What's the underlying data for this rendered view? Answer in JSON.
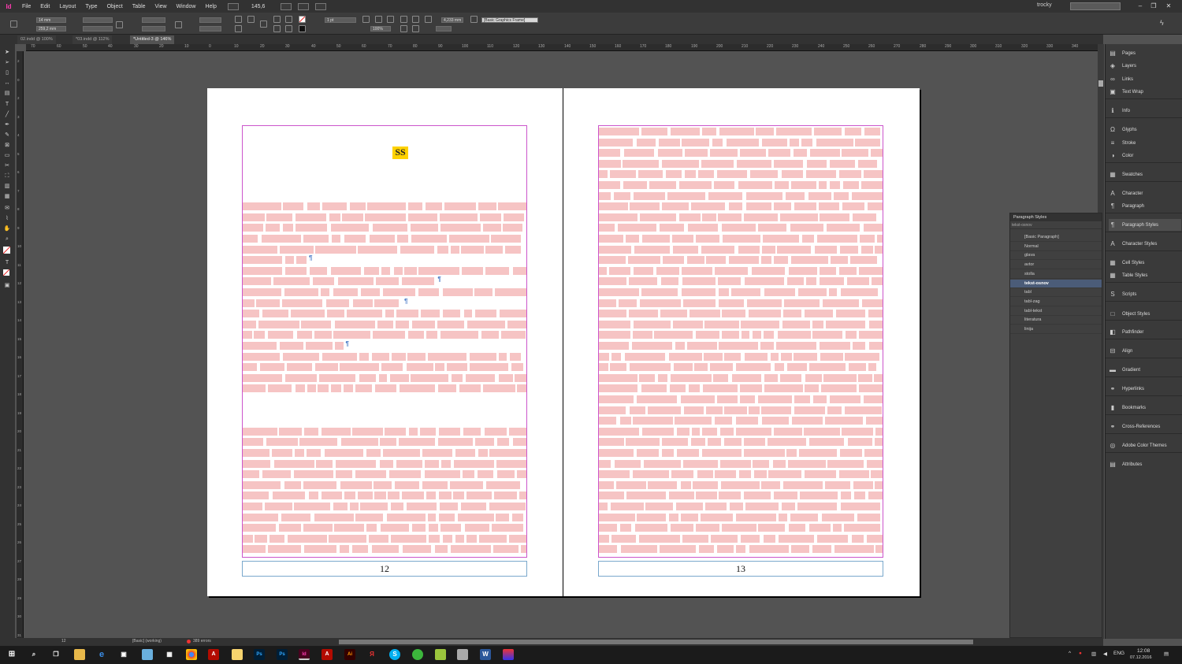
{
  "app": {
    "logo": "Id",
    "menu": [
      "File",
      "Edit",
      "Layout",
      "Type",
      "Object",
      "Table",
      "View",
      "Window",
      "Help"
    ],
    "zoom": "145,6",
    "user": "trocky"
  },
  "control_bar": {
    "x_value": "14 mm",
    "y_value": "259,2 mm",
    "stroke_weight": "1 pt",
    "scale_percent": "100%",
    "measure": "4,233 mm",
    "frame_style": "[Basic Graphics Frame]"
  },
  "tabs": [
    "02.indd @ 100%",
    "*03.indd @ 112%",
    "*Untitled-3 @ 146%"
  ],
  "ruler_top": [
    "70",
    "60",
    "50",
    "40",
    "30",
    "20",
    "10",
    "0",
    "10",
    "20",
    "30",
    "40",
    "50",
    "60",
    "70",
    "80",
    "90",
    "100",
    "110",
    "120",
    "130",
    "140",
    "150",
    "160",
    "170",
    "180",
    "190",
    "200",
    "210",
    "220",
    "230",
    "240",
    "250",
    "260",
    "270",
    "280",
    "290",
    "300",
    "310",
    "320",
    "330",
    "340",
    "350",
    "360",
    "370",
    "380",
    "390",
    "400",
    "410",
    "420",
    "430",
    "440",
    "450",
    "460",
    "470",
    "480",
    "490",
    "500",
    "510",
    "520",
    "530",
    "540",
    "550",
    "560",
    "570",
    "580",
    "590",
    "600",
    "610",
    "620",
    "630",
    "640",
    "650",
    "660",
    "670",
    "680",
    "690",
    "700",
    "710",
    "720",
    "730",
    "740",
    "750",
    "760",
    "770",
    "780",
    "790",
    "800",
    "810",
    "820",
    "830",
    "840",
    "850",
    "860",
    "870",
    "880",
    "890",
    "900",
    "910",
    "920",
    "930",
    "940",
    "950",
    "960",
    "970",
    "980",
    "990",
    "1000"
  ],
  "ruler_top_visible": [
    "70",
    "60",
    "50",
    "40",
    "30",
    "20",
    "10",
    "0",
    "10",
    "20",
    "30",
    "40",
    "50",
    "60",
    "70",
    "80",
    "90",
    "100",
    "110",
    "120",
    "130",
    "140",
    "150",
    "160",
    "170",
    "180",
    "190",
    "200",
    "210",
    "220",
    "230",
    "240",
    "250",
    "260",
    "270",
    "280",
    "290",
    "300",
    "310",
    "320",
    "330",
    "340",
    "350",
    "360",
    "370",
    "380",
    "390",
    "400",
    "410",
    "420",
    "430",
    "440",
    "450",
    "460",
    "470"
  ],
  "ruler_left": [
    "2",
    "0",
    "2",
    "3",
    "4",
    "5",
    "6",
    "7",
    "8",
    "9",
    "10",
    "11",
    "12",
    "13",
    "14",
    "15",
    "16",
    "17",
    "18",
    "19",
    "20",
    "21",
    "22",
    "23",
    "24",
    "25",
    "26",
    "27",
    "28",
    "29",
    "30",
    "31"
  ],
  "pages": {
    "left_number": "12",
    "right_number": "13",
    "heading_chip": "SS"
  },
  "panels": [
    {
      "label": "Pages",
      "icon": "▤"
    },
    {
      "label": "Layers",
      "icon": "◈"
    },
    {
      "label": "Links",
      "icon": "∞"
    },
    {
      "label": "Text Wrap",
      "icon": "▣"
    },
    {
      "label": "Info",
      "icon": "ℹ"
    },
    {
      "label": "Glyphs",
      "icon": "Ω"
    },
    {
      "label": "Stroke",
      "icon": "≡"
    },
    {
      "label": "Color",
      "icon": "◑"
    },
    {
      "label": "Swatches",
      "icon": "▦"
    },
    {
      "label": "Character",
      "icon": "A"
    },
    {
      "label": "Paragraph",
      "icon": "¶"
    },
    {
      "label": "Paragraph Styles",
      "icon": "¶"
    },
    {
      "label": "Character Styles",
      "icon": "A"
    },
    {
      "label": "Cell Styles",
      "icon": "▦"
    },
    {
      "label": "Table Styles",
      "icon": "▦"
    },
    {
      "label": "Scripts",
      "icon": "S"
    },
    {
      "label": "Object Styles",
      "icon": "□"
    },
    {
      "label": "Pathfinder",
      "icon": "◧"
    },
    {
      "label": "Align",
      "icon": "⊟"
    },
    {
      "label": "Gradient",
      "icon": "▬"
    },
    {
      "label": "Hyperlinks",
      "icon": "⚭"
    },
    {
      "label": "Bookmarks",
      "icon": "▮"
    },
    {
      "label": "Cross-References",
      "icon": "⚭"
    },
    {
      "label": "Adobe Color Themes",
      "icon": "◎"
    },
    {
      "label": "Attributes",
      "icon": "▤"
    }
  ],
  "paragraph_styles": {
    "title": "Paragraph Styles",
    "current": "tekst-osnov",
    "items": [
      "[Basic Paragraph]",
      "Normal",
      "glava",
      "avtor",
      "stolla",
      "tekst-osnov",
      "tabl",
      "tabl-zag",
      "tabl-tekst",
      "literatura",
      "linija"
    ]
  },
  "status": {
    "page": "12",
    "style": "[Basic] (working)",
    "errors": "389 errors"
  },
  "taskbar": {
    "lang": "ENG",
    "time": "12:08",
    "date": "07.12.2016"
  },
  "colors": {
    "accent": "#ff3bb1",
    "selection": "#4b5c78",
    "highlight": "#ffd200"
  }
}
